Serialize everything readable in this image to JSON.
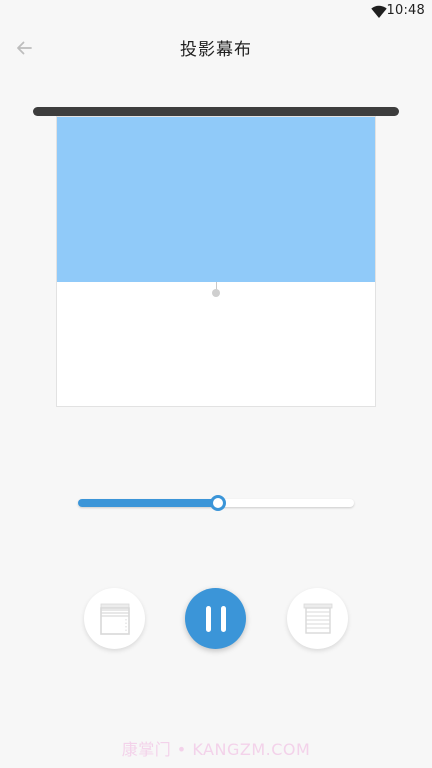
{
  "status_bar": {
    "time": "10:48",
    "icons": [
      "wifi-icon"
    ]
  },
  "header": {
    "title": "投影幕布",
    "back_icon": "arrow-left-icon"
  },
  "screen": {
    "deployed_fraction": 0.57,
    "fabric_color": "#90caf9",
    "rail_color": "#3d3d3d"
  },
  "slider": {
    "value_percent": 50,
    "accent_color": "#3b95d8"
  },
  "controls": {
    "buttons": [
      {
        "name": "open-button",
        "icon": "blind-open-icon"
      },
      {
        "name": "pause-button",
        "icon": "pause-icon"
      },
      {
        "name": "close-button",
        "icon": "blind-close-icon"
      }
    ]
  },
  "watermark": {
    "text": "康掌门 • KANGZM.COM"
  }
}
